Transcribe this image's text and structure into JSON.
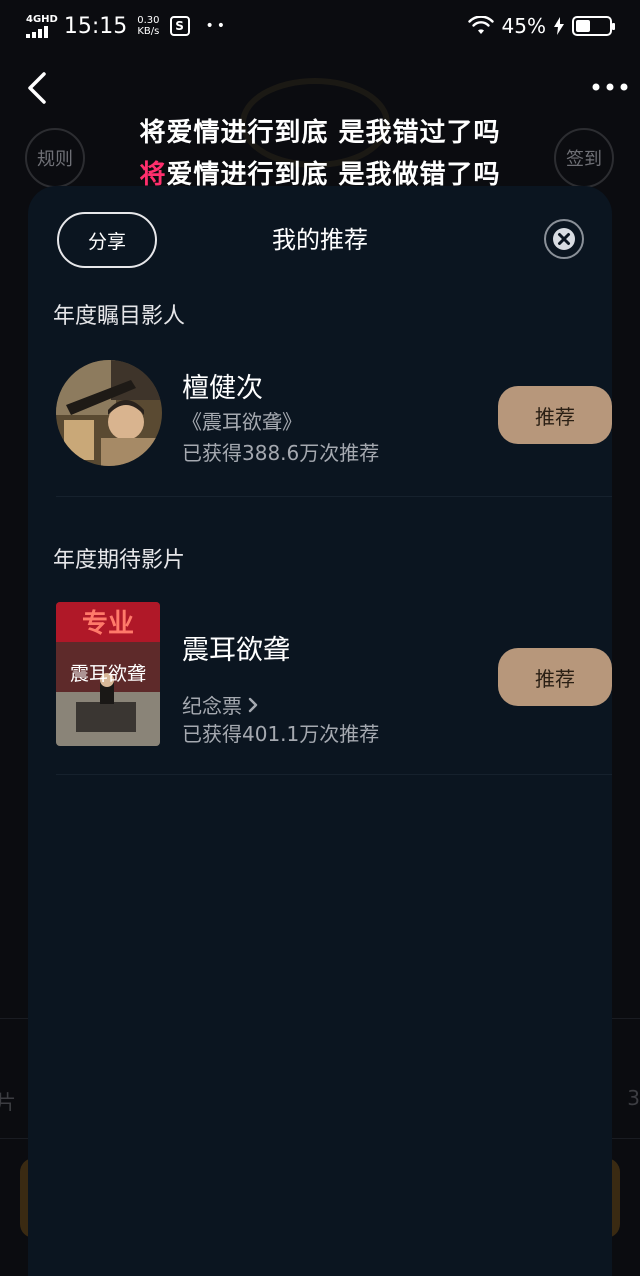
{
  "status_bar": {
    "network": "4GHD",
    "time": "15:15",
    "speed_value": "0.30",
    "speed_unit": "KB/s",
    "app_icon_letter": "S",
    "notification_dots": "••",
    "battery_percent": "45%",
    "battery_level": 0.45
  },
  "background": {
    "rule_label": "规则",
    "checkin_label": "签到",
    "lyric_line_1": "将爱情进行到底 是我错过了吗",
    "lyric_line_2_highlight": "将",
    "lyric_line_2_rest": "爱情进行到底 是我做错了吗",
    "ghost_left": "片",
    "ghost_right": "3"
  },
  "modal": {
    "share_label": "分享",
    "title": "我的推荐",
    "sections": [
      {
        "title": "年度瞩目影人",
        "item": {
          "name": "檀健次",
          "subtitle": "《震耳欲聋》",
          "count_text": "已获得388.6万次推荐",
          "button_label": "推荐"
        }
      },
      {
        "title": "年度期待影片",
        "item": {
          "name": "震耳欲聋",
          "subtitle": "纪念票",
          "count_text": "已获得401.1万次推荐",
          "button_label": "推荐",
          "poster_top_text": "专业",
          "poster_title_text": "震耳欲聋"
        }
      }
    ]
  },
  "colors": {
    "modal_bg": "#0b1520",
    "recommend_btn": "#b7977b",
    "lyric_highlight": "#ff2f6d"
  }
}
